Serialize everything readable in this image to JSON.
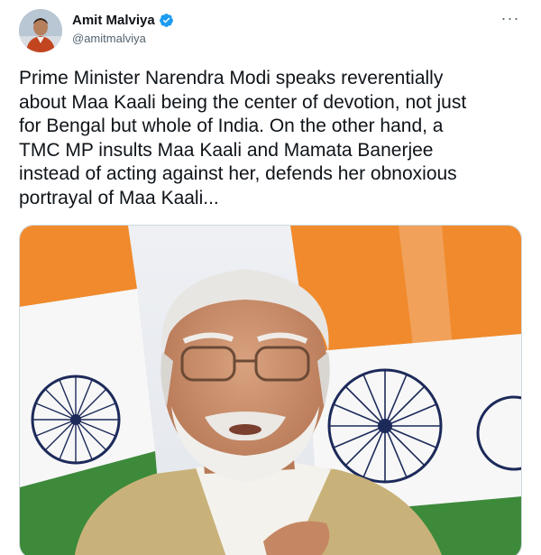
{
  "tweet": {
    "author_name": "Amit Malviya",
    "author_handle": "@amitmalviya",
    "verified": true,
    "more_label": "···",
    "text": "Prime Minister Narendra Modi speaks reverentially\nabout Maa Kaali being the center of devotion, not just\nfor Bengal but whole of India. On the other hand, a\nTMC MP insults Maa Kaali and Mamata Banerjee\ninstead of acting against her, defends her obnoxious\nportrayal of Maa Kaali..."
  },
  "icons": {
    "verified": "verified-badge-icon",
    "more": "more-options-icon"
  },
  "colors": {
    "verified_blue": "#1d9bf0",
    "text": "#0f1419",
    "secondary_text": "#536471",
    "saffron": "#f08a2c",
    "chakra_navy": "#1c2a5a"
  }
}
